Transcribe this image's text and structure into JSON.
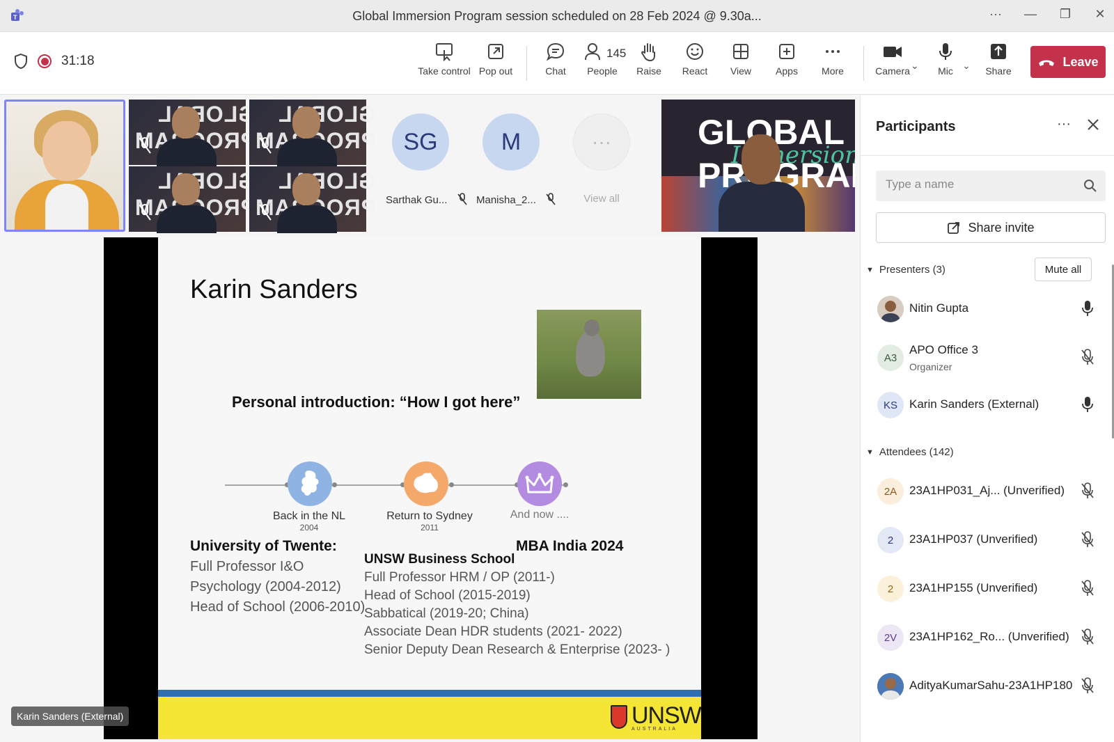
{
  "window": {
    "title": "Global Immersion Program session scheduled on 28 Feb 2024 @ 9.30a...",
    "more": "···"
  },
  "toolbar": {
    "timer": "31:18",
    "buttons": {
      "take_control": "Take control",
      "pop_out": "Pop out",
      "chat": "Chat",
      "people": "People",
      "people_count": "145",
      "raise": "Raise",
      "react": "React",
      "view": "View",
      "apps": "Apps",
      "more": "More",
      "camera": "Camera",
      "mic": "Mic",
      "share": "Share"
    },
    "leave": "Leave",
    "colors": {
      "leave": "#c4314b",
      "accent": "#5b5fc7"
    }
  },
  "gallery": {
    "poster_text_top": "GLOBAL",
    "poster_text_bottom": "PROGRAM",
    "avatars": [
      {
        "initials": "SG",
        "name": "Sarthak Gu..."
      },
      {
        "initials": "M",
        "name": "Manisha_2..."
      }
    ],
    "view_all": {
      "icon": "···",
      "label": "View all"
    },
    "featured": {
      "line1": "GLOBAL",
      "line2": "PROGRAM",
      "overlay": "Immersion"
    }
  },
  "slide": {
    "title": "Karin Sanders",
    "intro": "Personal introduction: “How I got here”",
    "timeline": [
      {
        "label": "Back in the NL",
        "year": "2004",
        "color": "#8fb4e3",
        "icon": "netherlands-map-icon"
      },
      {
        "label": "Return to Sydney",
        "year": "2011",
        "color": "#f4a86a",
        "icon": "australia-map-icon"
      },
      {
        "label": "And now ....",
        "year": "",
        "color": "#b38be0",
        "icon": "crown-icon"
      }
    ],
    "twente": {
      "heading": "University of Twente:",
      "lines": [
        "Full Professor I&O",
        "Psychology (2004-2012)",
        "Head of School (2006-2010)"
      ]
    },
    "unsw": {
      "heading": "UNSW Business School",
      "lines": [
        "Full Professor HRM / OP (2011-)",
        "Head of School (2015-2019)",
        "Sabbatical (2019-20; China)",
        "Associate Dean HDR students (2021- 2022)",
        "Senior Deputy Dean Research & Enterprise (2023-   )"
      ]
    },
    "mba": {
      "heading": "MBA India 2024"
    },
    "logo": "UNSW",
    "logo_sub": "AUSTRALIA"
  },
  "presenter_tag": "Karin Sanders (External)",
  "panel": {
    "title": "Participants",
    "search_placeholder": "Type a name",
    "share_invite": "Share invite",
    "presenters_header": "Presenters (3)",
    "mute_all": "Mute all",
    "attendees_header": "Attendees (142)",
    "presenters": [
      {
        "initials": "",
        "name": "Nitin Gupta",
        "sub": "",
        "mic": "on",
        "avatar_color": "#c9b8a8"
      },
      {
        "initials": "A3",
        "name": "APO Office 3",
        "sub": "Organizer",
        "mic": "off",
        "avatar_color": "#e3ece3"
      },
      {
        "initials": "KS",
        "name": "Karin Sanders (External)",
        "sub": "",
        "mic": "on",
        "avatar_color": "#dfe6f5"
      }
    ],
    "attendees": [
      {
        "initials": "2A",
        "name": "23A1HP031_Aj... (Unverified)",
        "mic": "off",
        "avatar_color": "#fbeedd"
      },
      {
        "initials": "2",
        "name": "23A1HP037 (Unverified)",
        "mic": "off",
        "avatar_color": "#e3e8f7"
      },
      {
        "initials": "2",
        "name": "23A1HP155 (Unverified)",
        "mic": "off",
        "avatar_color": "#fbf0d9"
      },
      {
        "initials": "2V",
        "name": "23A1HP162_Ro... (Unverified)",
        "mic": "off",
        "avatar_color": "#ece6f5"
      },
      {
        "initials": "",
        "name": "AdityaKumarSahu-23A1HP180",
        "mic": "off",
        "avatar_color": "#3f6aa0"
      }
    ]
  }
}
